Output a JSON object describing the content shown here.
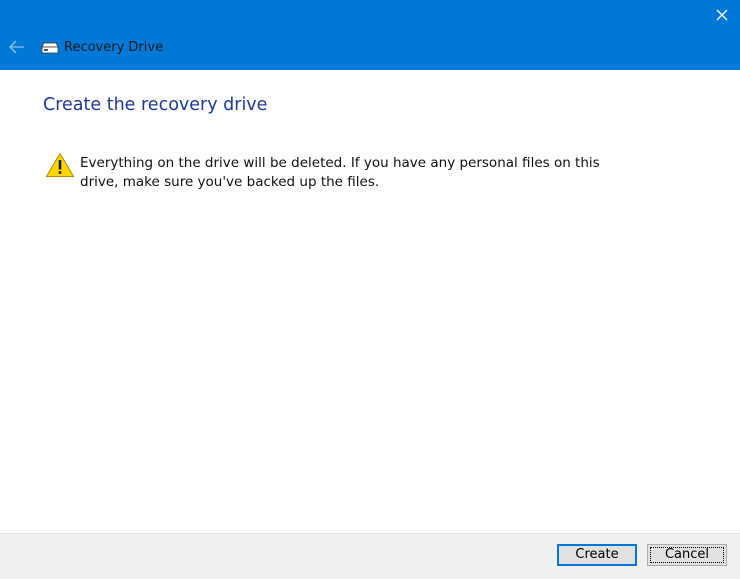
{
  "window": {
    "title": "Recovery Drive",
    "accent_color": "#0078d7",
    "icons": {
      "back": "back-arrow-icon",
      "app": "drive-icon",
      "close": "close-icon"
    }
  },
  "main": {
    "heading": "Create the recovery drive",
    "heading_color": "#1c3a94",
    "warning": {
      "icon": "warning-icon",
      "text": "Everything on the drive will be deleted. If you have any personal files on this drive, make sure you've backed up the files."
    }
  },
  "footer": {
    "create_label": "Create",
    "cancel_label": "Cancel"
  }
}
